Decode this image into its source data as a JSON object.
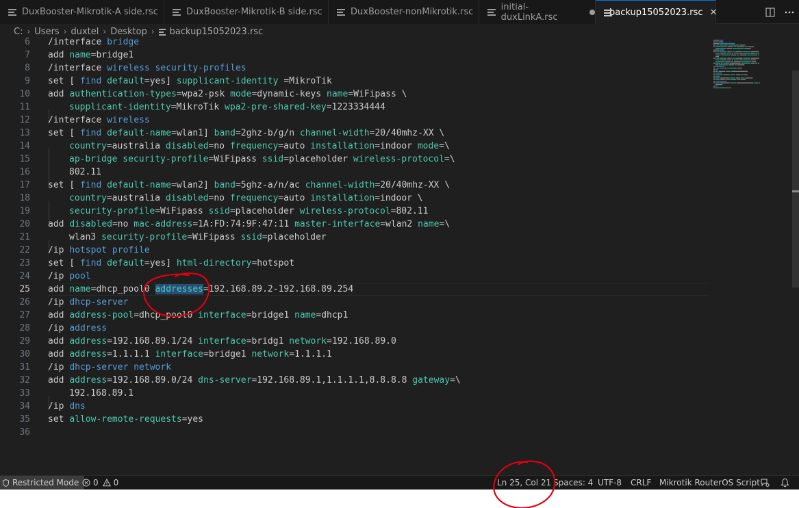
{
  "tabs": [
    {
      "label": "DuxBooster-Mikrotik-A side.rsc",
      "state": "normal"
    },
    {
      "label": "DuxBooster-Mikrotik-B side.rsc",
      "state": "normal"
    },
    {
      "label": "DuxBooster-nonMikrotik.rsc",
      "state": "normal"
    },
    {
      "label": "initial-duxLinkA.rsc",
      "state": "modified"
    },
    {
      "label": "backup15052023.rsc",
      "state": "active"
    }
  ],
  "tab_close_glyph": "✕",
  "breadcrumb": [
    "C:",
    "Users",
    "duxtel",
    "Desktop",
    "backup15052023.rsc"
  ],
  "line_numbers": [
    "6",
    "7",
    "8",
    "9",
    "10",
    "11",
    "12",
    "13",
    "14",
    "15",
    "16",
    "17",
    "18",
    "19",
    "20",
    "21",
    "22",
    "23",
    "24",
    "25",
    "26",
    "27",
    "28",
    "29",
    "30",
    "31",
    "32",
    "33",
    "34",
    "35",
    "36"
  ],
  "code": {
    "l6": [
      "/interface",
      "bridge"
    ],
    "l7": [
      "add",
      "name",
      "=bridge1"
    ],
    "l8": [
      "/interface",
      "wireless security-profiles"
    ],
    "l9": [
      "set",
      "[",
      "find",
      "default",
      "=yes",
      "]",
      "supplicant-identity",
      "=MikroTik"
    ],
    "l10": [
      "add",
      "authentication-types",
      "=wpa2-psk",
      "mode",
      "=dynamic-keys",
      "name",
      "=WiFipass \\"
    ],
    "l11": [
      "supplicant-identity",
      "=MikroTik",
      "wpa2-pre-shared-key",
      "=1223334444"
    ],
    "l12": [
      "/interface",
      "wireless"
    ],
    "l13": [
      "set",
      "[",
      "find",
      "default-name",
      "=wlan1",
      "]",
      "band",
      "=2ghz-b/g/n",
      "channel-width",
      "=20/40mhz-XX \\"
    ],
    "l14": [
      "country",
      "=australia",
      "disabled",
      "=no",
      "frequency",
      "=auto",
      "installation",
      "=indoor",
      "mode",
      "=\\"
    ],
    "l15": [
      "ap-bridge",
      "security-profile",
      "=WiFipass",
      "ssid",
      "=placeholder",
      "wireless-protocol",
      "=\\"
    ],
    "l16": [
      "802.11"
    ],
    "l17": [
      "set",
      "[",
      "find",
      "default-name",
      "=wlan2",
      "]",
      "band",
      "=5ghz-a/n/ac",
      "channel-width",
      "=20/40mhz-XX \\"
    ],
    "l18": [
      "country",
      "=australia",
      "disabled",
      "=no",
      "frequency",
      "=auto",
      "installation",
      "=indoor \\"
    ],
    "l19": [
      "security-profile",
      "=WiFipass",
      "ssid",
      "=placeholder",
      "wireless-protocol",
      "=802.11"
    ],
    "l20": [
      "add",
      "disabled",
      "=no",
      "mac-address",
      "=1A:FD:74:9F:47:11",
      "master-interface",
      "=wlan2",
      "name",
      "=\\"
    ],
    "l21": [
      "wlan3",
      "security-profile",
      "=WiFipass",
      "ssid",
      "=placeholder"
    ],
    "l22": [
      "/ip",
      "hotspot profile"
    ],
    "l23": [
      "set",
      "[",
      "find",
      "default",
      "=yes",
      "]",
      "html-directory",
      "=hotspot"
    ],
    "l24": [
      "/ip",
      "pool"
    ],
    "l25": [
      "add",
      "name",
      "=dhcp_pool0",
      "addresses",
      "=192.168.89.2-192.168.89.254"
    ],
    "l26": [
      "/ip",
      "dhcp-server"
    ],
    "l27": [
      "add",
      "address-pool",
      "=dhcp_pool0",
      "interface",
      "=bridge1",
      "name",
      "=dhcp1"
    ],
    "l28": [
      "/ip",
      "address"
    ],
    "l29": [
      "add",
      "address",
      "=192.168.89.1/24",
      "interface",
      "=bridg1",
      "network",
      "=192.168.89.0"
    ],
    "l30": [
      "add",
      "address",
      "=1.1.1.1",
      "interface",
      "=bridge1",
      "network",
      "=1.1.1.1"
    ],
    "l31": [
      "/ip",
      "dhcp-server network"
    ],
    "l32": [
      "add",
      "address",
      "=192.168.89.0/24",
      "dns-server",
      "=192.168.89.1,1.1.1.1,8.8.8.8",
      "gateway",
      "=\\"
    ],
    "l33": [
      "192.168.89.1"
    ],
    "l34": [
      "/ip",
      "dns"
    ],
    "l35": [
      "set",
      "allow-remote-requests",
      "=yes"
    ]
  },
  "current_line": "25",
  "statusbar": {
    "restricted": "Restricted Mode",
    "errors": "0",
    "warnings": "0",
    "position": "Ln 25, Col 21",
    "spaces": "Spaces: 4",
    "encoding": "UTF-8",
    "eol": "CRLF",
    "language": "Mikrotik RouterOS Script"
  },
  "colors": {
    "keyword_blue": "#569cd6",
    "command_teal": "#4ec9b0",
    "text": "#cccccc",
    "selection": "#264f78",
    "annotation_red": "#e0000f"
  }
}
